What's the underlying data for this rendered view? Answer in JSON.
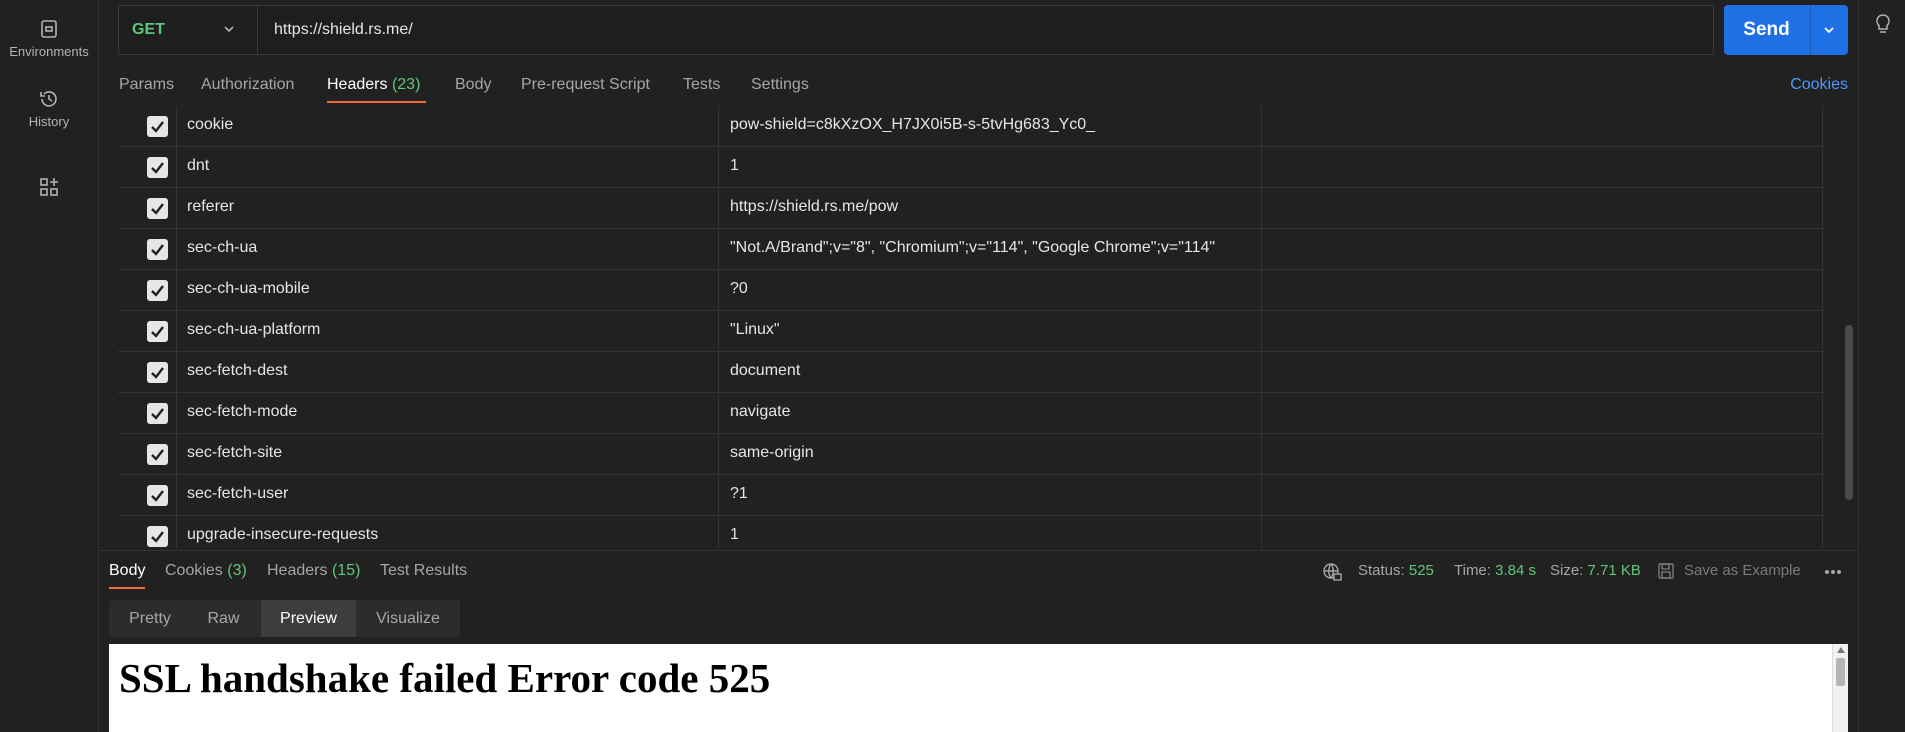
{
  "sidebar": {
    "environments": "Environments",
    "history": "History"
  },
  "request": {
    "method": "GET",
    "url": "https://shield.rs.me/",
    "send_label": "Send"
  },
  "request_tabs": {
    "params": "Params",
    "authorization": "Authorization",
    "headers": "Headers",
    "headers_count": "(23)",
    "body": "Body",
    "prerequest": "Pre-request Script",
    "tests": "Tests",
    "settings": "Settings",
    "cookies": "Cookies"
  },
  "headers": [
    {
      "key": "cookie",
      "value": "pow-shield=c8kXzOX_H7JX0i5B-s-5tvHg683_Yc0_"
    },
    {
      "key": "dnt",
      "value": "1"
    },
    {
      "key": "referer",
      "value": "https://shield.rs.me/pow"
    },
    {
      "key": "sec-ch-ua",
      "value": "\"Not.A/Brand\";v=\"8\", \"Chromium\";v=\"114\", \"Google Chrome\";v=\"114\""
    },
    {
      "key": "sec-ch-ua-mobile",
      "value": "?0"
    },
    {
      "key": "sec-ch-ua-platform",
      "value": "\"Linux\""
    },
    {
      "key": "sec-fetch-dest",
      "value": "document"
    },
    {
      "key": "sec-fetch-mode",
      "value": "navigate"
    },
    {
      "key": "sec-fetch-site",
      "value": "same-origin"
    },
    {
      "key": "sec-fetch-user",
      "value": "?1"
    },
    {
      "key": "upgrade-insecure-requests",
      "value": "1"
    }
  ],
  "response": {
    "tabs": {
      "body": "Body",
      "cookies": "Cookies",
      "cookies_count": "(3)",
      "headers": "Headers",
      "headers_count": "(15)",
      "test_results": "Test Results"
    },
    "status_label": "Status:",
    "status_value": "525",
    "time_label": "Time:",
    "time_value": "3.84 s",
    "size_label": "Size:",
    "size_value": "7.71 KB",
    "save_example": "Save as Example",
    "views": {
      "pretty": "Pretty",
      "raw": "Raw",
      "preview": "Preview",
      "visualize": "Visualize"
    },
    "preview_title": "SSL handshake failed Error code 525"
  },
  "colors": {
    "accent": "#f26b3a",
    "send": "#1f6fe5",
    "success": "#5fc77a",
    "link": "#4c9aff"
  }
}
